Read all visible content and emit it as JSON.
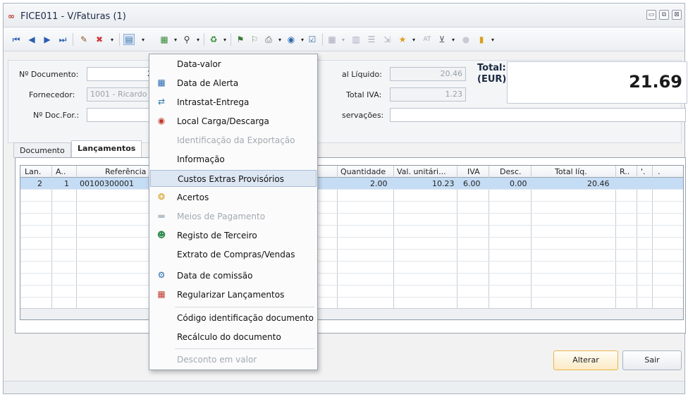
{
  "window": {
    "title": "FICE011 - V/Faturas  (1)",
    "app_icon": "∞",
    "controls": [
      "▭",
      "⧉",
      "⊠"
    ]
  },
  "toolbar": {
    "icons": [
      "first-icon",
      "prev-icon",
      "next-icon",
      "last-icon",
      "edit-icon",
      "delete-icon",
      "menu-icon",
      "print-preview-icon",
      "binoculars-icon",
      "recycle-icon",
      "stamp-icon",
      "stamp2-icon",
      "printer-icon",
      "globe-icon",
      "checklist-icon",
      "table-icon",
      "columns-icon",
      "list-icon",
      "export-icon",
      "star-icon",
      "at-icon",
      "filter-icon",
      "circle-icon",
      "door-icon"
    ],
    "at_label": "AT"
  },
  "header": {
    "doc_num_label": "Nº Documento:",
    "doc_num_value": "2",
    "supplier_label": "Fornecedor:",
    "supplier_value": "1001 - Ricardo",
    "doc_for_label": "Nº Doc.For.:",
    "doc_for_value": "",
    "total_liq_label": "al Líquido:",
    "total_liq_value": "20.46",
    "total_iva_label": "Total IVA:",
    "total_iva_value": "1.23",
    "obs_label": "servações:",
    "obs_value": "",
    "total_label_line1": "Total:",
    "total_label_line2": "(EUR)",
    "total_value": "21.69"
  },
  "tabs": [
    {
      "label": "Documento"
    },
    {
      "label": "Lançamentos"
    }
  ],
  "grid": {
    "columns": [
      "Lan.",
      "A..",
      "Referência",
      "Quantidade",
      "Val. unitári...",
      "IVA",
      "Desc.",
      "Total líq.",
      "R..",
      "'.",
      "."
    ],
    "rows": [
      {
        "lan": "2",
        "a": "1",
        "ref": "00100300001",
        "qty": "2.00",
        "unit": "10.23",
        "iva": "6.00",
        "desc": "0.00",
        "total": "20.46"
      }
    ]
  },
  "buttons": {
    "alterar": "Alterar",
    "sair": "Sair"
  },
  "menu": {
    "items": [
      {
        "label": "Data-valor",
        "icon": "",
        "enabled": true
      },
      {
        "label": "Data de Alerta",
        "icon": "calendar-alert-icon",
        "enabled": true
      },
      {
        "label": "Intrastat-Entrega",
        "icon": "delivery-icon",
        "enabled": true
      },
      {
        "label": "Local Carga/Descarga",
        "icon": "location-icon",
        "enabled": true
      },
      {
        "label": "Identificação da Exportação",
        "icon": "",
        "enabled": false
      },
      {
        "label": "Informação",
        "icon": "",
        "enabled": true
      },
      {
        "label": "Custos Extras Provisórios",
        "icon": "",
        "enabled": true,
        "hover": true
      },
      {
        "label": "Acertos",
        "icon": "coins-icon",
        "enabled": true
      },
      {
        "label": "Meios de Pagamento",
        "icon": "payment-icon",
        "enabled": false
      },
      {
        "label": "Registo de Terceiro",
        "icon": "person-icon",
        "enabled": true
      },
      {
        "label": "Extrato de Compras/Vendas",
        "icon": "",
        "enabled": true
      },
      {
        "label": "Data de comissão",
        "icon": "commission-icon",
        "enabled": true
      },
      {
        "label": "Regularizar Lançamentos",
        "icon": "regularize-icon",
        "enabled": true
      },
      {
        "label": "Código identificação documento",
        "icon": "",
        "enabled": true
      },
      {
        "label": "Recálculo do documento",
        "icon": "",
        "enabled": true
      },
      {
        "label": "Desconto em valor",
        "icon": "",
        "enabled": false
      }
    ]
  },
  "colors": {
    "selection": "#c5dcf5",
    "menu_hover": "#dde7f3",
    "highlight_button": "#fbeac5"
  }
}
